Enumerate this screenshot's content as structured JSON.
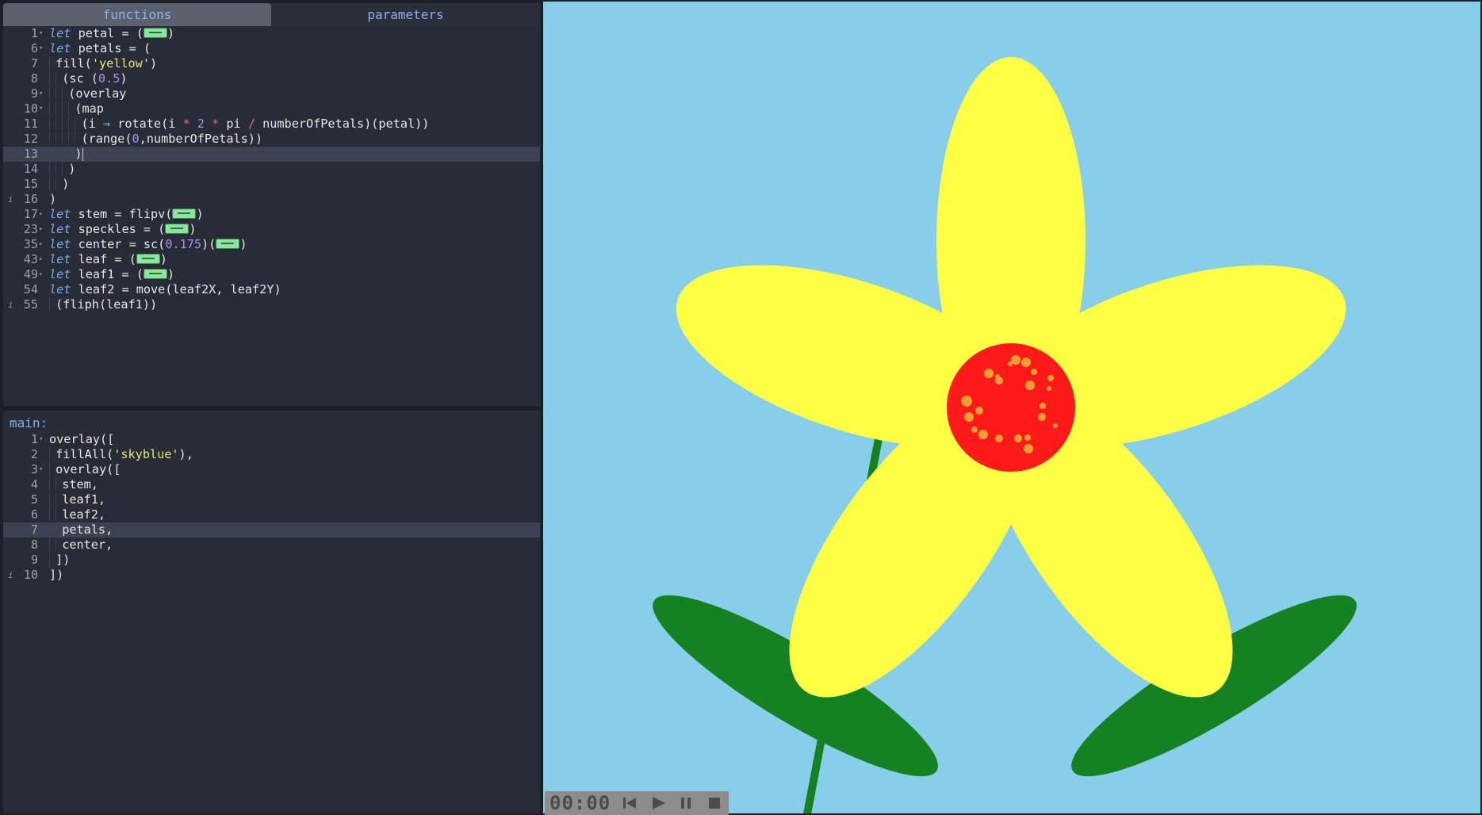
{
  "tabs": {
    "functions_label": "functions",
    "parameters_label": "parameters"
  },
  "main_editor": {
    "label": "main:"
  },
  "player": {
    "time": "00:00",
    "rewind_icon": "skip-to-start-icon",
    "play_icon": "play-icon",
    "pause_icon": "pause-icon",
    "stop_icon": "stop-icon"
  },
  "canvas": {
    "background": "#87ceeb",
    "petal_color": "#ffff44",
    "center_color": "#ff1a1a",
    "speckle_color": "#f0a030",
    "leaf_color": "#148221",
    "stem_color": "#148221"
  },
  "functions_code": [
    {
      "ln": "1",
      "fold": "▾",
      "tokens": [
        [
          "kw",
          "let"
        ],
        [
          "",
          "petal = ("
        ],
        [
          "widget",
          ""
        ],
        [
          "",
          ")"
        ]
      ]
    },
    {
      "ln": "6",
      "fold": "▾",
      "tokens": [
        [
          "kw",
          "let"
        ],
        [
          "",
          "petals = ("
        ]
      ]
    },
    {
      "ln": "7",
      "fold": "",
      "tokens": [
        [
          "",
          "fill("
        ],
        [
          "str",
          "'yellow'"
        ],
        [
          "",
          ")"
        ]
      ]
    },
    {
      "ln": "8",
      "fold": "",
      "tokens": [
        [
          "",
          "(sc ("
        ],
        [
          "num",
          "0.5"
        ],
        [
          "",
          ")"
        ]
      ]
    },
    {
      "ln": "9",
      "fold": "▾",
      "tokens": [
        [
          "",
          "(overlay"
        ]
      ]
    },
    {
      "ln": "10",
      "fold": "▾",
      "tokens": [
        [
          "",
          "(map"
        ]
      ]
    },
    {
      "ln": "11",
      "fold": "",
      "tokens": [
        [
          "",
          "(i "
        ],
        [
          "arrow",
          "⇒"
        ],
        [
          "",
          " rotate(i "
        ],
        [
          "op",
          "*"
        ],
        [
          "num",
          " 2"
        ],
        [
          "op",
          " *"
        ],
        [
          "",
          " pi "
        ],
        [
          "op",
          "/"
        ],
        [
          "",
          " numberOfPetals)(petal))"
        ]
      ]
    },
    {
      "ln": "12",
      "fold": "",
      "tokens": [
        [
          "",
          "(range("
        ],
        [
          "num",
          "0"
        ],
        [
          "",
          ",numberOfPetals))"
        ]
      ]
    },
    {
      "ln": "13",
      "fold": "",
      "tokens": [
        [
          "",
          ")"
        ]
      ]
    },
    {
      "ln": "14",
      "fold": "",
      "tokens": [
        [
          "",
          ")"
        ]
      ]
    },
    {
      "ln": "15",
      "fold": "",
      "tokens": [
        [
          "",
          ")"
        ]
      ]
    },
    {
      "ln": "16",
      "fold": "",
      "mark": "i",
      "tokens": [
        [
          "",
          ")"
        ]
      ]
    },
    {
      "ln": "17",
      "fold": "▸",
      "tokens": [
        [
          "kw",
          "let"
        ],
        [
          "",
          "stem = flipv("
        ],
        [
          "widget",
          ""
        ],
        [
          "",
          ")"
        ]
      ]
    },
    {
      "ln": "23",
      "fold": "▸",
      "tokens": [
        [
          "kw",
          "let"
        ],
        [
          "",
          "speckles = ("
        ],
        [
          "widget",
          ""
        ],
        [
          "",
          ")"
        ]
      ]
    },
    {
      "ln": "35",
      "fold": "▸",
      "tokens": [
        [
          "kw",
          "let"
        ],
        [
          "",
          "center = sc("
        ],
        [
          "num",
          "0.175"
        ],
        [
          "",
          ")("
        ],
        [
          "widget",
          ""
        ],
        [
          "",
          ")"
        ]
      ]
    },
    {
      "ln": "43",
      "fold": "▸",
      "tokens": [
        [
          "kw",
          "let"
        ],
        [
          "",
          "leaf = ("
        ],
        [
          "widget",
          ""
        ],
        [
          "",
          ")"
        ]
      ]
    },
    {
      "ln": "49",
      "fold": "▸",
      "tokens": [
        [
          "kw",
          "let"
        ],
        [
          "",
          "leaf1 = ("
        ],
        [
          "widget",
          ""
        ],
        [
          "",
          ")"
        ]
      ]
    },
    {
      "ln": "54",
      "fold": "",
      "tokens": [
        [
          "kw",
          "let"
        ],
        [
          "",
          "leaf2 = move(leaf2X, leaf2Y)"
        ]
      ]
    },
    {
      "ln": "55",
      "fold": "",
      "mark": "i",
      "tokens": [
        [
          "",
          "(fliph(leaf1))"
        ]
      ]
    }
  ],
  "main_code": [
    {
      "ln": "1",
      "fold": "▾",
      "tokens": [
        [
          "",
          "overlay(["
        ]
      ]
    },
    {
      "ln": "2",
      "fold": "",
      "tokens": [
        [
          "",
          "fillAll("
        ],
        [
          "str",
          "'skyblue'"
        ],
        [
          "",
          "),"
        ]
      ]
    },
    {
      "ln": "3",
      "fold": "▾",
      "tokens": [
        [
          "",
          "overlay(["
        ]
      ]
    },
    {
      "ln": "4",
      "fold": "",
      "tokens": [
        [
          "",
          "stem,"
        ]
      ]
    },
    {
      "ln": "5",
      "fold": "",
      "tokens": [
        [
          "",
          "leaf1,"
        ]
      ]
    },
    {
      "ln": "6",
      "fold": "",
      "tokens": [
        [
          "",
          "leaf2,"
        ]
      ]
    },
    {
      "ln": "7",
      "fold": "",
      "tokens": [
        [
          "",
          "petals,"
        ]
      ]
    },
    {
      "ln": "8",
      "fold": "",
      "tokens": [
        [
          "",
          "center,"
        ]
      ]
    },
    {
      "ln": "9",
      "fold": "",
      "tokens": [
        [
          "",
          "])"
        ]
      ]
    },
    {
      "ln": "10",
      "fold": "",
      "mark": "i",
      "tokens": [
        [
          "",
          "])"
        ]
      ]
    }
  ]
}
